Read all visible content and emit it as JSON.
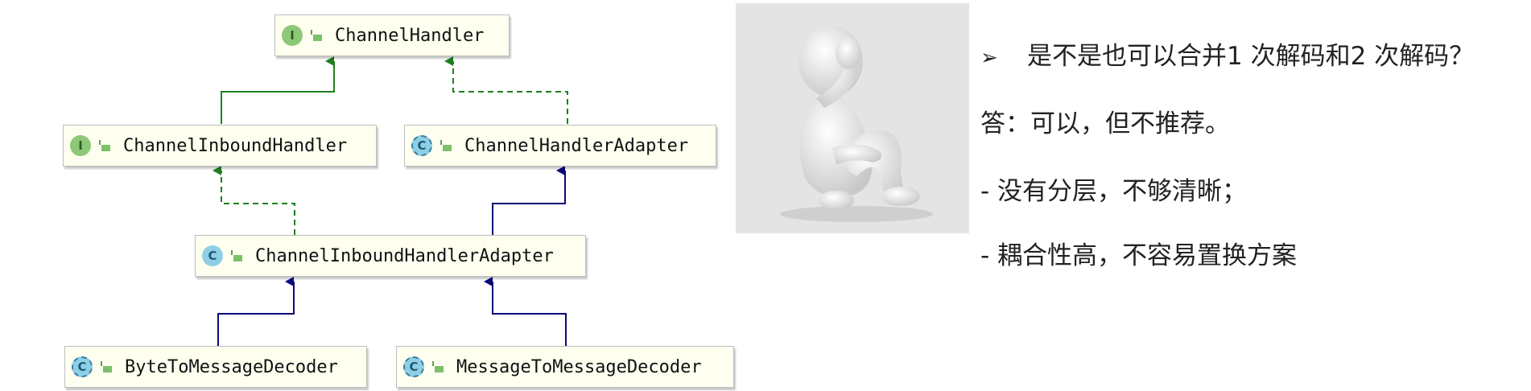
{
  "diagram": {
    "nodes": {
      "channel_handler": {
        "kind": "I",
        "label": "ChannelHandler"
      },
      "channel_inbound_handler": {
        "kind": "I",
        "label": "ChannelInboundHandler"
      },
      "channel_handler_adapter": {
        "kind": "C",
        "label": "ChannelHandlerAdapter"
      },
      "channel_inbound_handler_adapter": {
        "kind": "C",
        "label": "ChannelInboundHandlerAdapter"
      },
      "byte_to_message_decoder": {
        "kind": "C",
        "label": "ByteToMessageDecoder"
      },
      "message_to_message_decoder": {
        "kind": "C",
        "label": "MessageToMessageDecoder"
      }
    },
    "colors": {
      "extends": "#0a0a7a",
      "implements": "#1f7f1f",
      "interface_extends": "#1f7f1f"
    }
  },
  "photo": {
    "icon": "facepalm-figure"
  },
  "text": {
    "bullet": "➢",
    "question": "是不是也可以合并1 次解码和2 次解码？",
    "answer": "答：可以，但不推荐。",
    "reason1": "- 没有分层，不够清晰；",
    "reason2": "- 耦合性高，不容易置换方案"
  }
}
